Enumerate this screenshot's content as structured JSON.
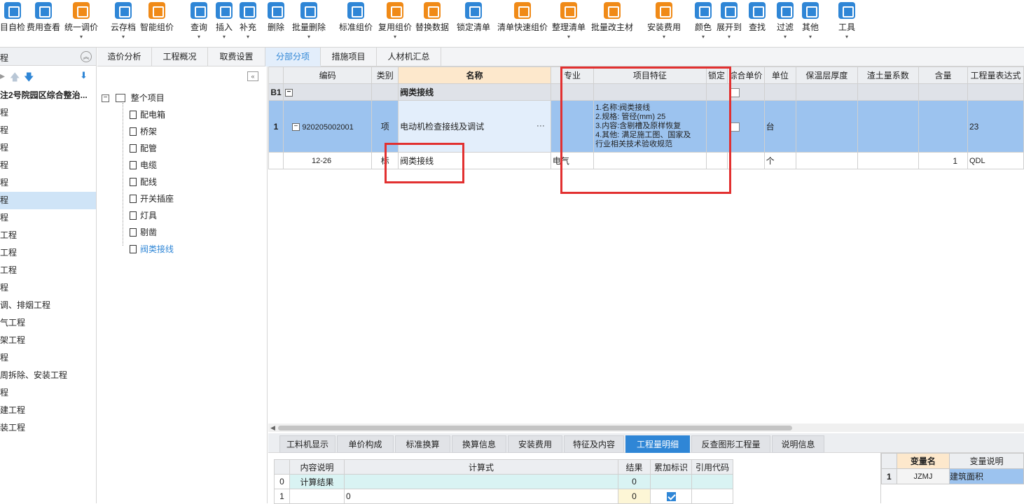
{
  "toolbar": {
    "items": [
      {
        "label": "目自检",
        "icon": "self-check-icon",
        "dd": false
      },
      {
        "label": "费用查看",
        "icon": "fee-view-icon",
        "dd": false
      },
      {
        "label": "统一调价",
        "icon": "unified-price-icon",
        "dd": true
      },
      {
        "label": "云存档",
        "icon": "cloud-save-icon",
        "dd": true
      },
      {
        "label": "智能组价",
        "icon": "smart-price-icon",
        "dd": false
      },
      {
        "label": "查询",
        "icon": "query-icon",
        "dd": true
      },
      {
        "label": "插入",
        "icon": "insert-icon",
        "dd": true
      },
      {
        "label": "补充",
        "icon": "supplement-icon",
        "dd": true
      },
      {
        "label": "删除",
        "icon": "delete-icon",
        "dd": false
      },
      {
        "label": "批量删除",
        "icon": "batch-delete-icon",
        "dd": true
      },
      {
        "label": "标准组价",
        "icon": "standard-price-icon",
        "dd": false
      },
      {
        "label": "复用组价",
        "icon": "reuse-price-icon",
        "dd": true
      },
      {
        "label": "替换数据",
        "icon": "replace-data-icon",
        "dd": false
      },
      {
        "label": "锁定清单",
        "icon": "lock-list-icon",
        "dd": false
      },
      {
        "label": "清单快速组价",
        "icon": "quick-price-icon",
        "dd": false
      },
      {
        "label": "整理清单",
        "icon": "organize-list-icon",
        "dd": true
      },
      {
        "label": "批量改主材",
        "icon": "batch-material-icon",
        "dd": false
      },
      {
        "label": "安装费用",
        "icon": "install-fee-icon",
        "dd": true
      },
      {
        "label": "颜色",
        "icon": "color-icon",
        "dd": true
      },
      {
        "label": "展开到",
        "icon": "expand-to-icon",
        "dd": true
      },
      {
        "label": "查找",
        "icon": "find-icon",
        "dd": false
      },
      {
        "label": "过滤",
        "icon": "filter-icon",
        "dd": true
      },
      {
        "label": "其他",
        "icon": "other-icon",
        "dd": true
      },
      {
        "label": "工具",
        "icon": "tools-icon",
        "dd": true
      }
    ]
  },
  "left_panel": {
    "header": "程",
    "items": [
      "注2号院园区综合整治...",
      "程",
      "程",
      "程",
      "程",
      "程",
      "程",
      "程",
      "工程",
      "工程",
      "工程",
      "程",
      "调、排烟工程",
      "气工程",
      "架工程",
      "程",
      "周拆除、安装工程",
      "程",
      "建工程",
      "装工程"
    ],
    "selected_index": 6
  },
  "top_tabs": [
    {
      "label": "造价分析"
    },
    {
      "label": "工程概况"
    },
    {
      "label": "取费设置"
    },
    {
      "label": "分部分项",
      "active": true
    },
    {
      "label": "措施项目"
    },
    {
      "label": "人材机汇总"
    }
  ],
  "tree": {
    "root": "整个项目",
    "children": [
      "配电箱",
      "桥架",
      "配管",
      "电缆",
      "配线",
      "开关插座",
      "灯具",
      "剔凿",
      "阀类接线"
    ],
    "selected": "阀类接线"
  },
  "grid": {
    "headers": [
      "编码",
      "类别",
      "名称",
      "专业",
      "项目特征",
      "锁定",
      "综合单价",
      "单位",
      "保温层厚度",
      "渣土量系数",
      "含量",
      "工程量表达式"
    ],
    "division_row": {
      "index": "B1",
      "name": "阀类接线"
    },
    "item_row": {
      "index": "1",
      "code": "920205002001",
      "type": "项",
      "name": "电动机检查接线及调试",
      "features": [
        "1.名称:阀类接线",
        "2.规格: 管径(mm) 25",
        "3.内容:含剔槽及原样恢复",
        "4.其他: 满足施工图、国家及",
        "行业相关技术验收规范"
      ],
      "unit": "台",
      "quantity_expr": "23"
    },
    "quota_row": {
      "code": "12-26",
      "type": "标",
      "name": "阀类接线",
      "specialty": "电气",
      "unit": "个",
      "content": "1",
      "quantity_expr": "QDL"
    }
  },
  "bottom_tabs": [
    {
      "label": "工料机显示"
    },
    {
      "label": "单价构成"
    },
    {
      "label": "标准换算"
    },
    {
      "label": "换算信息"
    },
    {
      "label": "安装费用"
    },
    {
      "label": "特征及内容"
    },
    {
      "label": "工程量明细",
      "active": true
    },
    {
      "label": "反查图形工程量"
    },
    {
      "label": "说明信息"
    }
  ],
  "calc_table": {
    "headers": [
      "内容说明",
      "计算式",
      "结果",
      "累加标识",
      "引用代码"
    ],
    "rows": [
      {
        "idx": "0",
        "desc": "计算结果",
        "formula": "",
        "result": "0"
      },
      {
        "idx": "1",
        "desc": "",
        "formula": "0",
        "result": "0"
      }
    ]
  },
  "var_table": {
    "headers": [
      "变量名",
      "变量说明"
    ],
    "rows": [
      {
        "idx": "1",
        "name": "JZMJ",
        "desc": "建筑面积"
      }
    ]
  },
  "colors": {
    "accent": "#2f86d6",
    "selected_row": "#9cc3ef",
    "highlight_box": "#e23030"
  }
}
